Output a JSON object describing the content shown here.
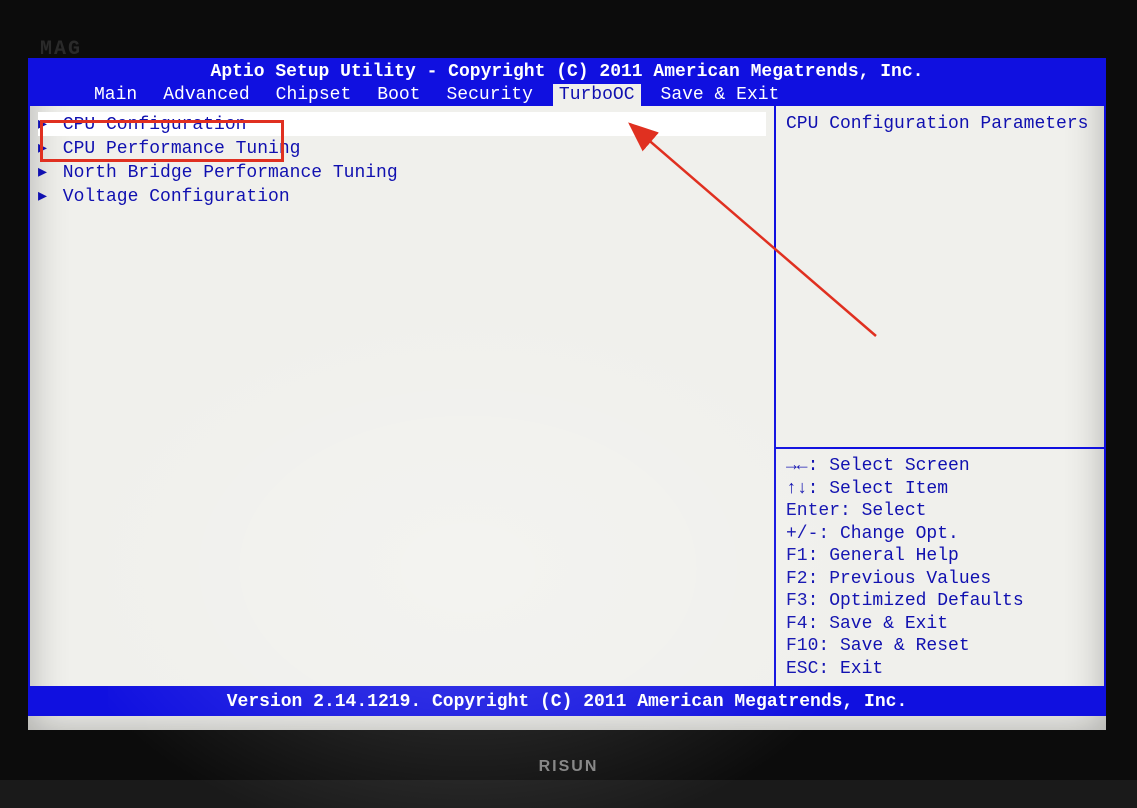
{
  "header": {
    "title": "Aptio Setup Utility - Copyright (C) 2011 American Megatrends, Inc.",
    "tabs": [
      {
        "label": "Main",
        "active": false
      },
      {
        "label": "Advanced",
        "active": false
      },
      {
        "label": "Chipset",
        "active": false
      },
      {
        "label": "Boot",
        "active": false
      },
      {
        "label": "Security",
        "active": false
      },
      {
        "label": "TurboOC",
        "active": true
      },
      {
        "label": "Save & Exit",
        "active": false
      }
    ]
  },
  "menu": {
    "items": [
      {
        "label": "CPU Configuration",
        "selected": true
      },
      {
        "label": "CPU Performance Tuning",
        "selected": false
      },
      {
        "label": "North Bridge Performance Tuning",
        "selected": false
      },
      {
        "label": "Voltage Configuration",
        "selected": false
      }
    ]
  },
  "help": {
    "description": "CPU Configuration Parameters",
    "keys": [
      "→←: Select Screen",
      "↑↓: Select Item",
      "Enter: Select",
      "+/-: Change Opt.",
      "F1: General Help",
      "F2: Previous Values",
      "F3: Optimized Defaults",
      "F4: Save & Exit",
      "F10: Save & Reset",
      "ESC: Exit"
    ]
  },
  "footer": {
    "text": "Version 2.14.1219. Copyright (C) 2011 American Megatrends, Inc."
  },
  "monitor": {
    "brand_top": "MAG",
    "brand_bottom": "RISUN"
  }
}
